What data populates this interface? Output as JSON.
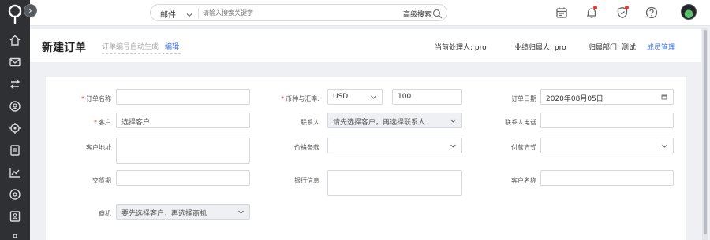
{
  "sidebar": {
    "logo_icon": "logo-icon",
    "collapse_glyph": "›",
    "items": [
      {
        "name": "home-icon"
      },
      {
        "name": "mail-icon"
      },
      {
        "name": "transfer-icon"
      },
      {
        "name": "customer-icon"
      },
      {
        "name": "target-icon"
      },
      {
        "name": "document-icon"
      },
      {
        "name": "chart-icon"
      },
      {
        "name": "location-icon"
      },
      {
        "name": "contact-card-icon"
      }
    ]
  },
  "topbar": {
    "search": {
      "scope": "邮件",
      "placeholder": "请输入搜索关键字",
      "advanced": "高级搜索"
    },
    "icons": [
      "calendar-icon",
      "bell-icon",
      "shield-check-icon",
      "help-icon"
    ]
  },
  "header": {
    "title": "新建订单",
    "order_no_hint": "订单编号自动生成",
    "edit_label": "编辑",
    "handler_label": "当前处理人:",
    "handler_value": "pro",
    "owner_label": "业绩归属人:",
    "owner_value": "pro",
    "dept_label": "归属部门:",
    "dept_value": "测试",
    "members_label": "成员管理"
  },
  "form": {
    "order_name_label": "订单名称",
    "order_name_value": "",
    "currency_label": "币种与汇率:",
    "currency_value": "USD",
    "rate_value": "100",
    "order_date_label": "订单日期",
    "order_date_value": "2020年08月05日",
    "customer_label": "客户",
    "customer_placeholder": "选择客户",
    "contact_label": "联系人",
    "contact_placeholder": "请先选择客户，再选择联系人",
    "contact_phone_label": "联系人电话",
    "customer_address_label": "客户地址",
    "price_terms_label": "价格条款",
    "payment_label": "付款方式",
    "delivery_label": "交货期",
    "bank_label": "银行信息",
    "customer_name_label": "客户名称",
    "opportunity_label": "商机",
    "opportunity_placeholder": "要先选择客户，再选择商机"
  },
  "colors": {
    "sidebar": "#2e3033",
    "accent": "#3b6fe0",
    "required": "#e53935"
  }
}
